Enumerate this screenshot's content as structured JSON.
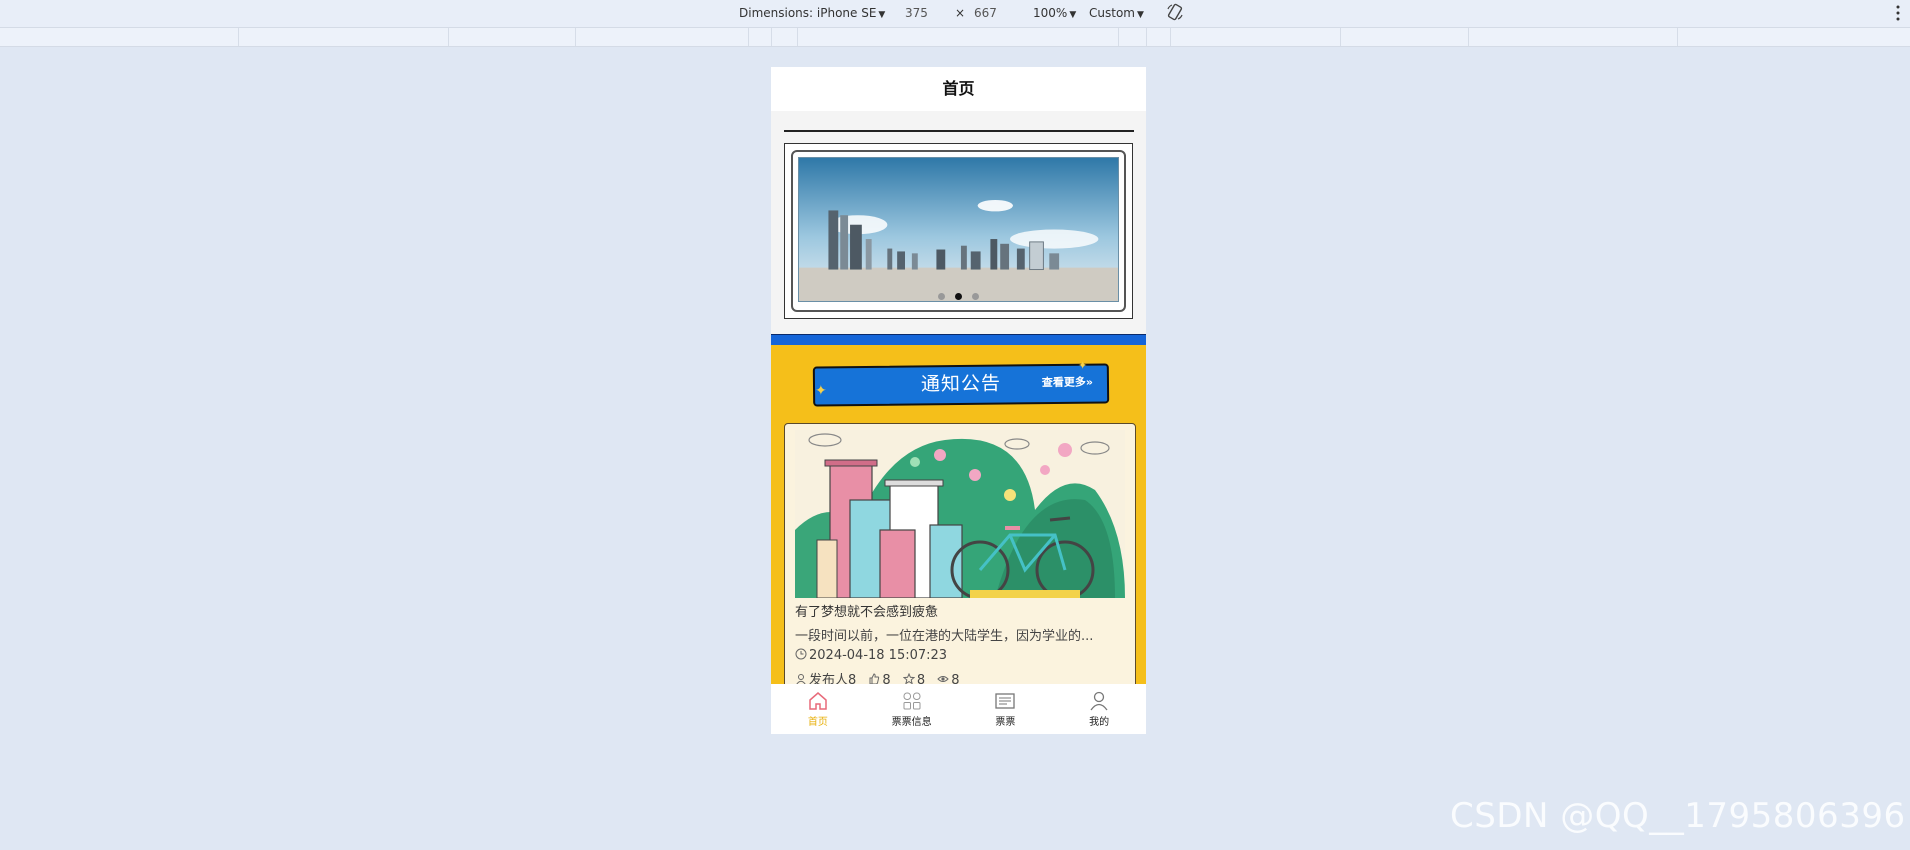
{
  "devtools": {
    "dimensions_label": "Dimensions: iPhone SE",
    "width": "375",
    "times": "×",
    "height": "667",
    "zoom": "100%",
    "throttle": "Custom"
  },
  "page": {
    "title": "首页"
  },
  "banner": {
    "dot_count": 3,
    "active_dot": 1
  },
  "notice": {
    "title": "通知公告",
    "more": "查看更多»"
  },
  "card": {
    "title": "有了梦想就不会感到疲惫",
    "desc": "一段时间以前，一位在港的大陆学生，因为学业的...",
    "time": "2024-04-18 15:07:23",
    "publisher": "发布人8",
    "likes": "8",
    "favorites": "8",
    "views": "8"
  },
  "tabbar": [
    {
      "label": "首页",
      "icon": "home-icon",
      "active": true
    },
    {
      "label": "票票信息",
      "icon": "grid-icon",
      "active": false
    },
    {
      "label": "票票",
      "icon": "news-icon",
      "active": false
    },
    {
      "label": "我的",
      "icon": "user-icon",
      "active": false
    }
  ],
  "watermark": "CSDN @QQ__1795806396",
  "colors": {
    "page_bg": "#dfe7f3",
    "yellow": "#f5bf1a",
    "blue": "#1673d8",
    "tab_active": "#e8b10f"
  }
}
